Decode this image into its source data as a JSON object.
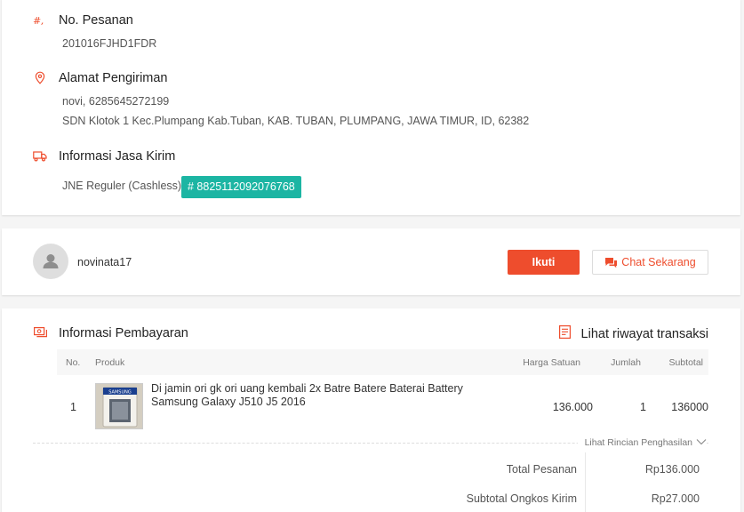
{
  "order": {
    "order_no_title": "No. Pesanan",
    "order_no": "201016FJHD1FDR",
    "address_title": "Alamat Pengiriman",
    "recipient": "novi, 6285645272199",
    "address": "SDN Klotok 1 Kec.Plumpang Kab.Tuban, KAB. TUBAN, PLUMPANG, JAWA TIMUR, ID, 62382",
    "shipping_title": "Informasi Jasa Kirim",
    "courier": "JNE Reguler (Cashless)",
    "tracking": "# 8825112092076768",
    "tracking_color": "#1cb5a3"
  },
  "seller": {
    "username": "novinata17",
    "follow_label": "Ikuti",
    "chat_label": "Chat Sekarang",
    "accent": "#ee4d2d"
  },
  "payment": {
    "title": "Informasi Pembayaran",
    "history_link": "Lihat riwayat transaksi",
    "columns": {
      "no": "No.",
      "product": "Produk",
      "unit_price": "Harga Satuan",
      "qty": "Jumlah",
      "subtotal": "Subtotal"
    },
    "rows": [
      {
        "no": "1",
        "name": "Di jamin ori gk ori uang kembali 2x Batre Batere Baterai Battery Samsung Galaxy J510 J5 2016",
        "image_label": "SAMSUNG",
        "unit_price": "136.000",
        "qty": "1",
        "subtotal": "136000"
      }
    ],
    "details_link": "Lihat Rincian Penghasilan",
    "summary": [
      {
        "label": "Total Pesanan",
        "value": "Rp136.000"
      },
      {
        "label": "Subtotal Ongkos Kirim",
        "value": "Rp27.000"
      }
    ]
  },
  "icons": {
    "order_no": "hash-icon",
    "address": "location-pin-icon",
    "shipping": "truck-icon",
    "payment": "payment-icon",
    "history": "receipt-icon",
    "chat": "chat-bubble-icon",
    "avatar": "user-silhouette-icon",
    "chevron": "chevron-down-icon"
  }
}
